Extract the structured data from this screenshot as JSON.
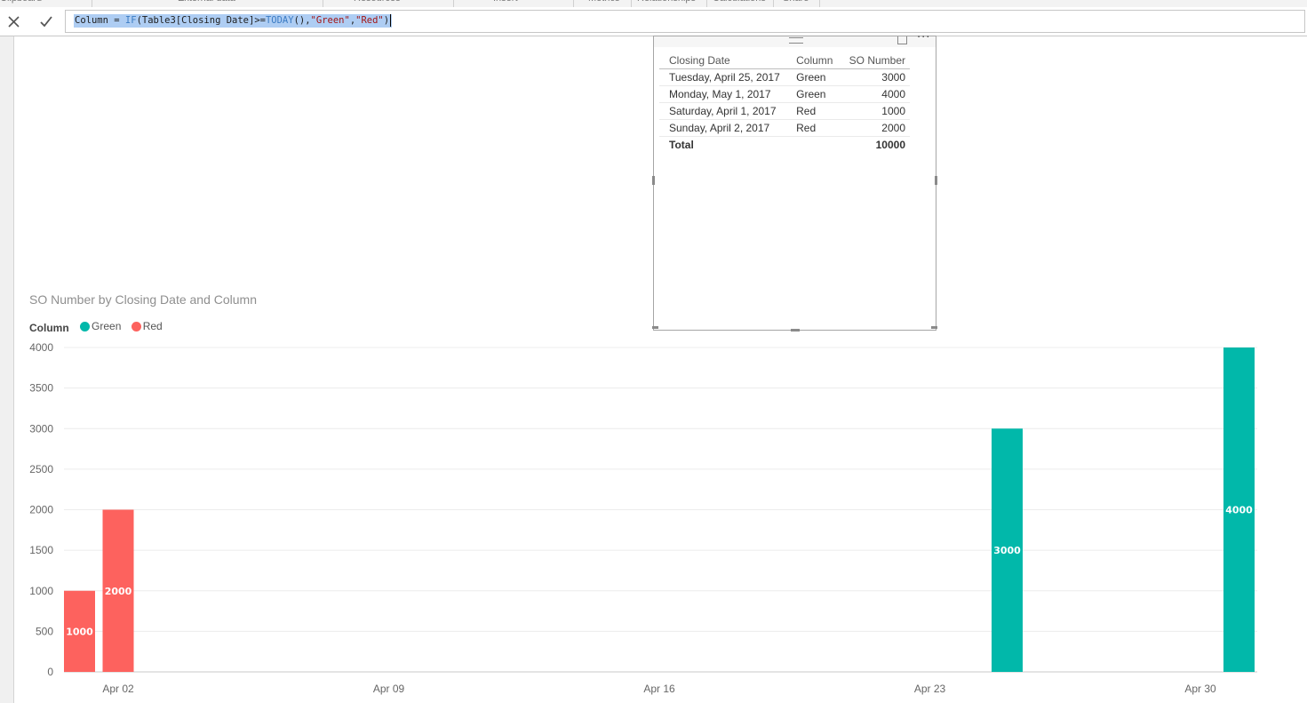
{
  "ribbon": {
    "groups": [
      "Clipboard",
      "External data",
      "Resources",
      "Insert",
      "Metrics",
      "Relationships",
      "Calculations",
      "Share"
    ]
  },
  "formula_bar": {
    "cancel_icon": "close-icon",
    "commit_icon": "checkmark-icon",
    "tokens": [
      {
        "text": "Column = ",
        "kind": "plain"
      },
      {
        "text": "IF",
        "kind": "fn"
      },
      {
        "text": "(Table3[Closing Date]>=",
        "kind": "plain"
      },
      {
        "text": "TODAY",
        "kind": "fn"
      },
      {
        "text": "(),",
        "kind": "plain"
      },
      {
        "text": "\"Green\"",
        "kind": "str"
      },
      {
        "text": ",",
        "kind": "plain"
      },
      {
        "text": "\"Red\"",
        "kind": "str"
      },
      {
        "text": ")",
        "kind": "plain"
      }
    ]
  },
  "table_visual": {
    "headers": [
      "Closing Date",
      "Column",
      "SO Number"
    ],
    "rows": [
      [
        "Tuesday, April 25, 2017",
        "Green",
        "3000"
      ],
      [
        "Monday, May 1, 2017",
        "Green",
        "4000"
      ],
      [
        "Saturday, April 1, 2017",
        "Red",
        "1000"
      ],
      [
        "Sunday, April 2, 2017",
        "Red",
        "2000"
      ]
    ],
    "total_label": "Total",
    "total_value": "10000",
    "more_icon": "ellipsis-icon",
    "focus_icon": "focus-mode-icon"
  },
  "chart": {
    "title": "SO Number by Closing Date and Column",
    "legend_title": "Column",
    "legend": [
      {
        "name": "Green",
        "color": "#01b8aa"
      },
      {
        "name": "Red",
        "color": "#fd625e"
      }
    ]
  },
  "chart_data": {
    "type": "bar",
    "title": "SO Number by Closing Date and Column",
    "xlabel": "",
    "ylabel": "",
    "x_axis": "date",
    "x_tick_labels": [
      "Apr 02",
      "Apr 09",
      "Apr 16",
      "Apr 23",
      "Apr 30"
    ],
    "y_ticks": [
      0,
      500,
      1000,
      1500,
      2000,
      2500,
      3000,
      3500,
      4000
    ],
    "ylim": [
      0,
      4000
    ],
    "grid": true,
    "legend_position": "top-left",
    "series": [
      {
        "name": "Red",
        "color": "#fd625e",
        "points": [
          {
            "x": "2017-04-01",
            "y": 1000
          },
          {
            "x": "2017-04-02",
            "y": 2000
          }
        ]
      },
      {
        "name": "Green",
        "color": "#01b8aa",
        "points": [
          {
            "x": "2017-04-25",
            "y": 3000
          },
          {
            "x": "2017-05-01",
            "y": 4000
          }
        ]
      }
    ]
  }
}
